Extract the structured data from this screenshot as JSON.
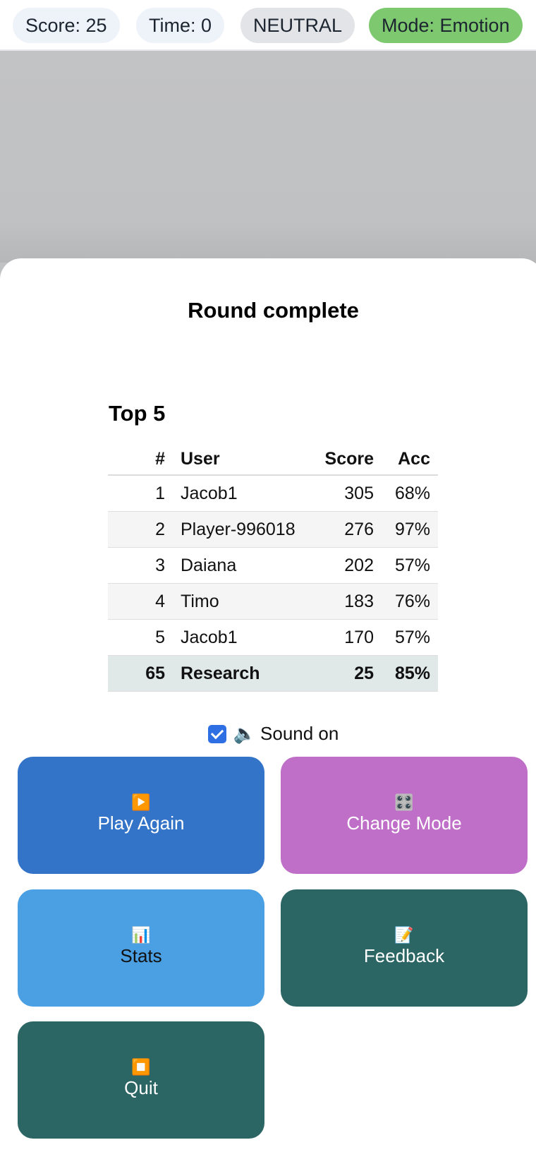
{
  "topbar": {
    "score": "Score: 25",
    "time": "Time: 0",
    "state": "NEUTRAL",
    "mode": "Mode: Emotion"
  },
  "dialog": {
    "title": "Round complete",
    "leaderboard_title": "Top 5",
    "columns": [
      "#",
      "User",
      "Score",
      "Acc"
    ],
    "rows": [
      {
        "rank": "1",
        "user": "Jacob1",
        "score": "305",
        "acc": "68%"
      },
      {
        "rank": "2",
        "user": "Player-996018",
        "score": "276",
        "acc": "97%"
      },
      {
        "rank": "3",
        "user": "Daiana",
        "score": "202",
        "acc": "57%"
      },
      {
        "rank": "4",
        "user": "Timo",
        "score": "183",
        "acc": "76%"
      },
      {
        "rank": "5",
        "user": "Jacob1",
        "score": "170",
        "acc": "57%"
      }
    ],
    "self_row": {
      "rank": "65",
      "user": "Research",
      "score": "25",
      "acc": "85%"
    },
    "sound": {
      "label": "Sound on",
      "checked": true,
      "icon": "🔈"
    },
    "buttons": {
      "play_again": {
        "label": "Play Again",
        "icon": "▶️"
      },
      "change_mode": {
        "label": "Change Mode",
        "icon": "🎛️"
      },
      "stats": {
        "label": "Stats",
        "icon": "📊"
      },
      "feedback": {
        "label": "Feedback",
        "icon": "📝"
      },
      "quit": {
        "label": "Quit",
        "icon": "⏹️"
      }
    }
  },
  "colors": {
    "mode_pill": "#7ec86f",
    "play_again": "#3474c8",
    "change_mode": "#bf6fc8",
    "stats": "#4aa0e2",
    "feedback": "#2b6564",
    "quit": "#2b6564"
  }
}
